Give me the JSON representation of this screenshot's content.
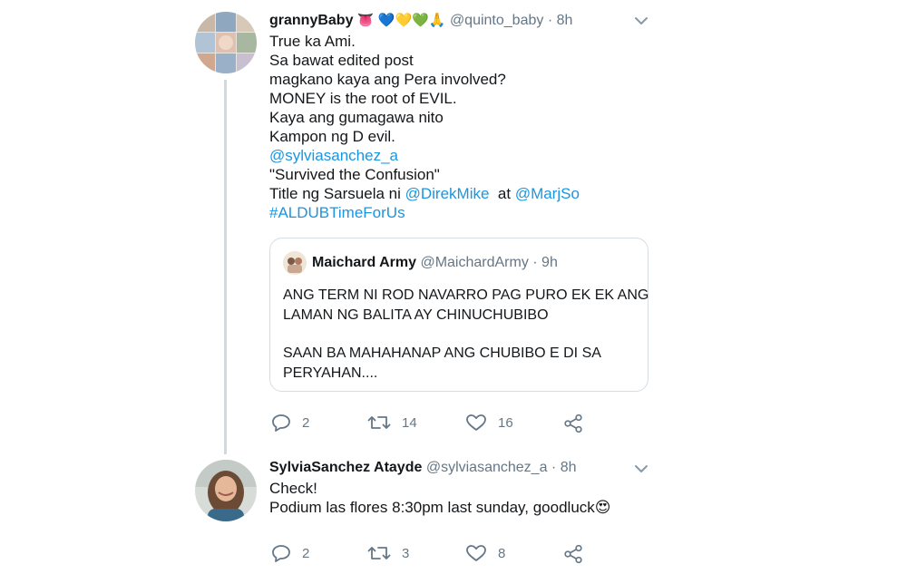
{
  "tweets": [
    {
      "display_name": "grannyBaby",
      "name_emoji": "👅 💙💛💚🙏",
      "handle": "@quinto_baby",
      "time": "· 8h",
      "lines": [
        "True ka Ami.",
        "Sa bawat edited post",
        "magkano kaya ang Pera involved?",
        "MONEY is the root of EVIL.",
        "Kaya ang gumagawa nito",
        "Kampon ng D evil."
      ],
      "mention": "@sylviasanchez_a",
      "quote_line": "\"Survived the Confusion\"",
      "title_prefix": "Title ng Sarsuela ni ",
      "title_mention1": "@DirekMike",
      "title_at": "  at ",
      "title_mention2": "@MarjSo",
      "hashtag": "#ALDUBTimeForUs",
      "quoted": {
        "display_name": "Maichard Army",
        "handle": "@MaichardArmy",
        "time": "· 9h",
        "lines": [
          "ANG TERM NI ROD NAVARRO PAG PURO EK EK ANG",
          "LAMAN NG BALITA AY CHINUCHUBIBO",
          "",
          "SAAN BA MAHAHANAP ANG CHUBIBO E DI SA",
          "PERYAHAN...."
        ]
      },
      "replies": "2",
      "retweets": "14",
      "likes": "16"
    },
    {
      "display_name": "SylviaSanchez Atayde",
      "handle": "@sylviasanchez_a",
      "time": "· 8h",
      "lines": [
        "Check!",
        "Podium las flores 8:30pm last sunday, goodluck😍"
      ],
      "replies": "2",
      "retweets": "3",
      "likes": "8"
    }
  ],
  "icons": {
    "reply": "reply-icon",
    "retweet": "retweet-icon",
    "like": "heart-icon",
    "share": "share-icon",
    "menu": "chevron-down-icon"
  },
  "colors": {
    "link": "#1b95e0",
    "secondary_text": "#657786",
    "thread_line": "#cfd9de"
  }
}
